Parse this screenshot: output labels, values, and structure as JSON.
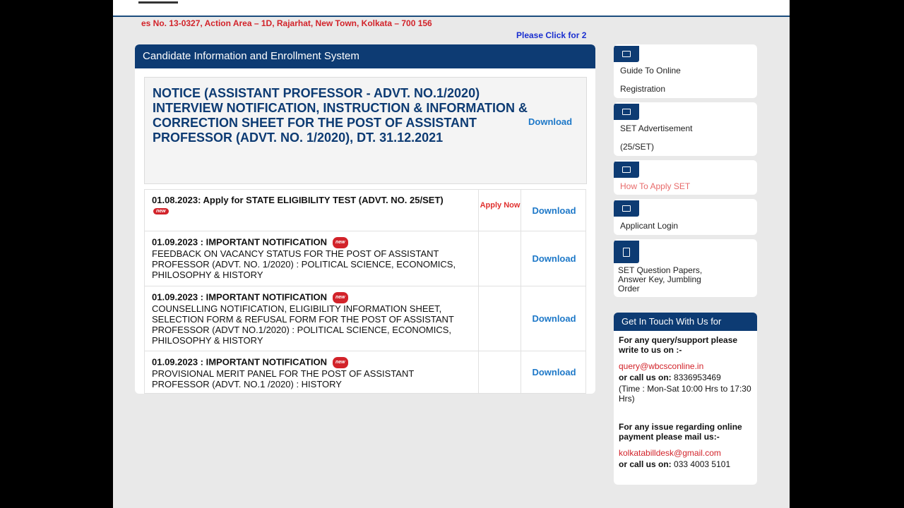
{
  "ticker": {
    "address": "es No. 13-0327, Action Area – 1D, Rajarhat, New Town, Kolkata – 700 156",
    "click": "Please Click for 2"
  },
  "main": {
    "title": "Candidate Information and Enrollment System",
    "notice": {
      "line1": "NOTICE (ASSISTANT PROFESSOR - ADVT. NO.1/2020)",
      "line2": "INTERVIEW NOTIFICATION, INSTRUCTION & INFORMATION & CORRECTION SHEET FOR THE POST OF ASSISTANT PROFESSOR (ADVT. NO. 1/2020), Dt. 31.12.2021",
      "download": "Download"
    },
    "rows": [
      {
        "title": "01.08.2023: Apply for STATE ELIGIBILITY TEST (ADVT. NO. 25/SET)",
        "desc": "",
        "apply": "Apply Now",
        "download": "Download"
      },
      {
        "title": "01.09.2023 : IMPORTANT NOTIFICATION",
        "desc": "FEEDBACK ON VACANCY STATUS FOR THE POST OF ASSISTANT PROFESSOR (ADVT. NO. 1/2020) : POLITICAL SCIENCE, ECONOMICS, PHILOSOPHY & HISTORY",
        "apply": "",
        "download": "Download"
      },
      {
        "title": "01.09.2023 : IMPORTANT NOTIFICATION",
        "desc": "COUNSELLING NOTIFICATION, ELIGIBILITY INFORMATION SHEET, SELECTION FORM & REFUSAL FORM FOR THE POST OF ASSISTANT PROFESSOR (ADVT NO.1/2020) : POLITICAL SCIENCE, ECONOMICS, PHILOSOPHY & HISTORY",
        "apply": "",
        "download": "Download"
      },
      {
        "title": "01.09.2023 : IMPORTANT NOTIFICATION",
        "desc": "PROVISIONAL MERIT PANEL FOR THE POST OF ASSISTANT PROFESSOR (ADVT. NO.1 /2020) : HISTORY",
        "apply": "",
        "download": "Download"
      }
    ],
    "badge": "new"
  },
  "sidebar": {
    "guide": {
      "line1": "Guide To Online",
      "line2": "Registration"
    },
    "advert": {
      "line1": "SET Advertisement",
      "line2": "(25/SET)"
    },
    "howto": "How To Apply SET",
    "login": "Applicant Login",
    "papers": "SET Question Papers, Answer Key, Jumbling Order"
  },
  "contact": {
    "title": "Get In Touch With Us for",
    "query_label": "For any query/support please write to us on :-",
    "query_email": "query@wbcsconline.in",
    "call_label": "or call us on:",
    "call_number": "8336953469",
    "time": "(Time : Mon-Sat 10:00 Hrs to 17:30 Hrs)",
    "payment_label": "For any issue regarding online payment please mail us:-",
    "payment_email": "kolkatabilldesk@gmail.com",
    "call_label2": "or call us on:",
    "call_number2": "033 4003 5101"
  },
  "colors": {
    "navy": "#0d3b73",
    "link_blue": "#1d78c8",
    "red": "#d2232a"
  }
}
